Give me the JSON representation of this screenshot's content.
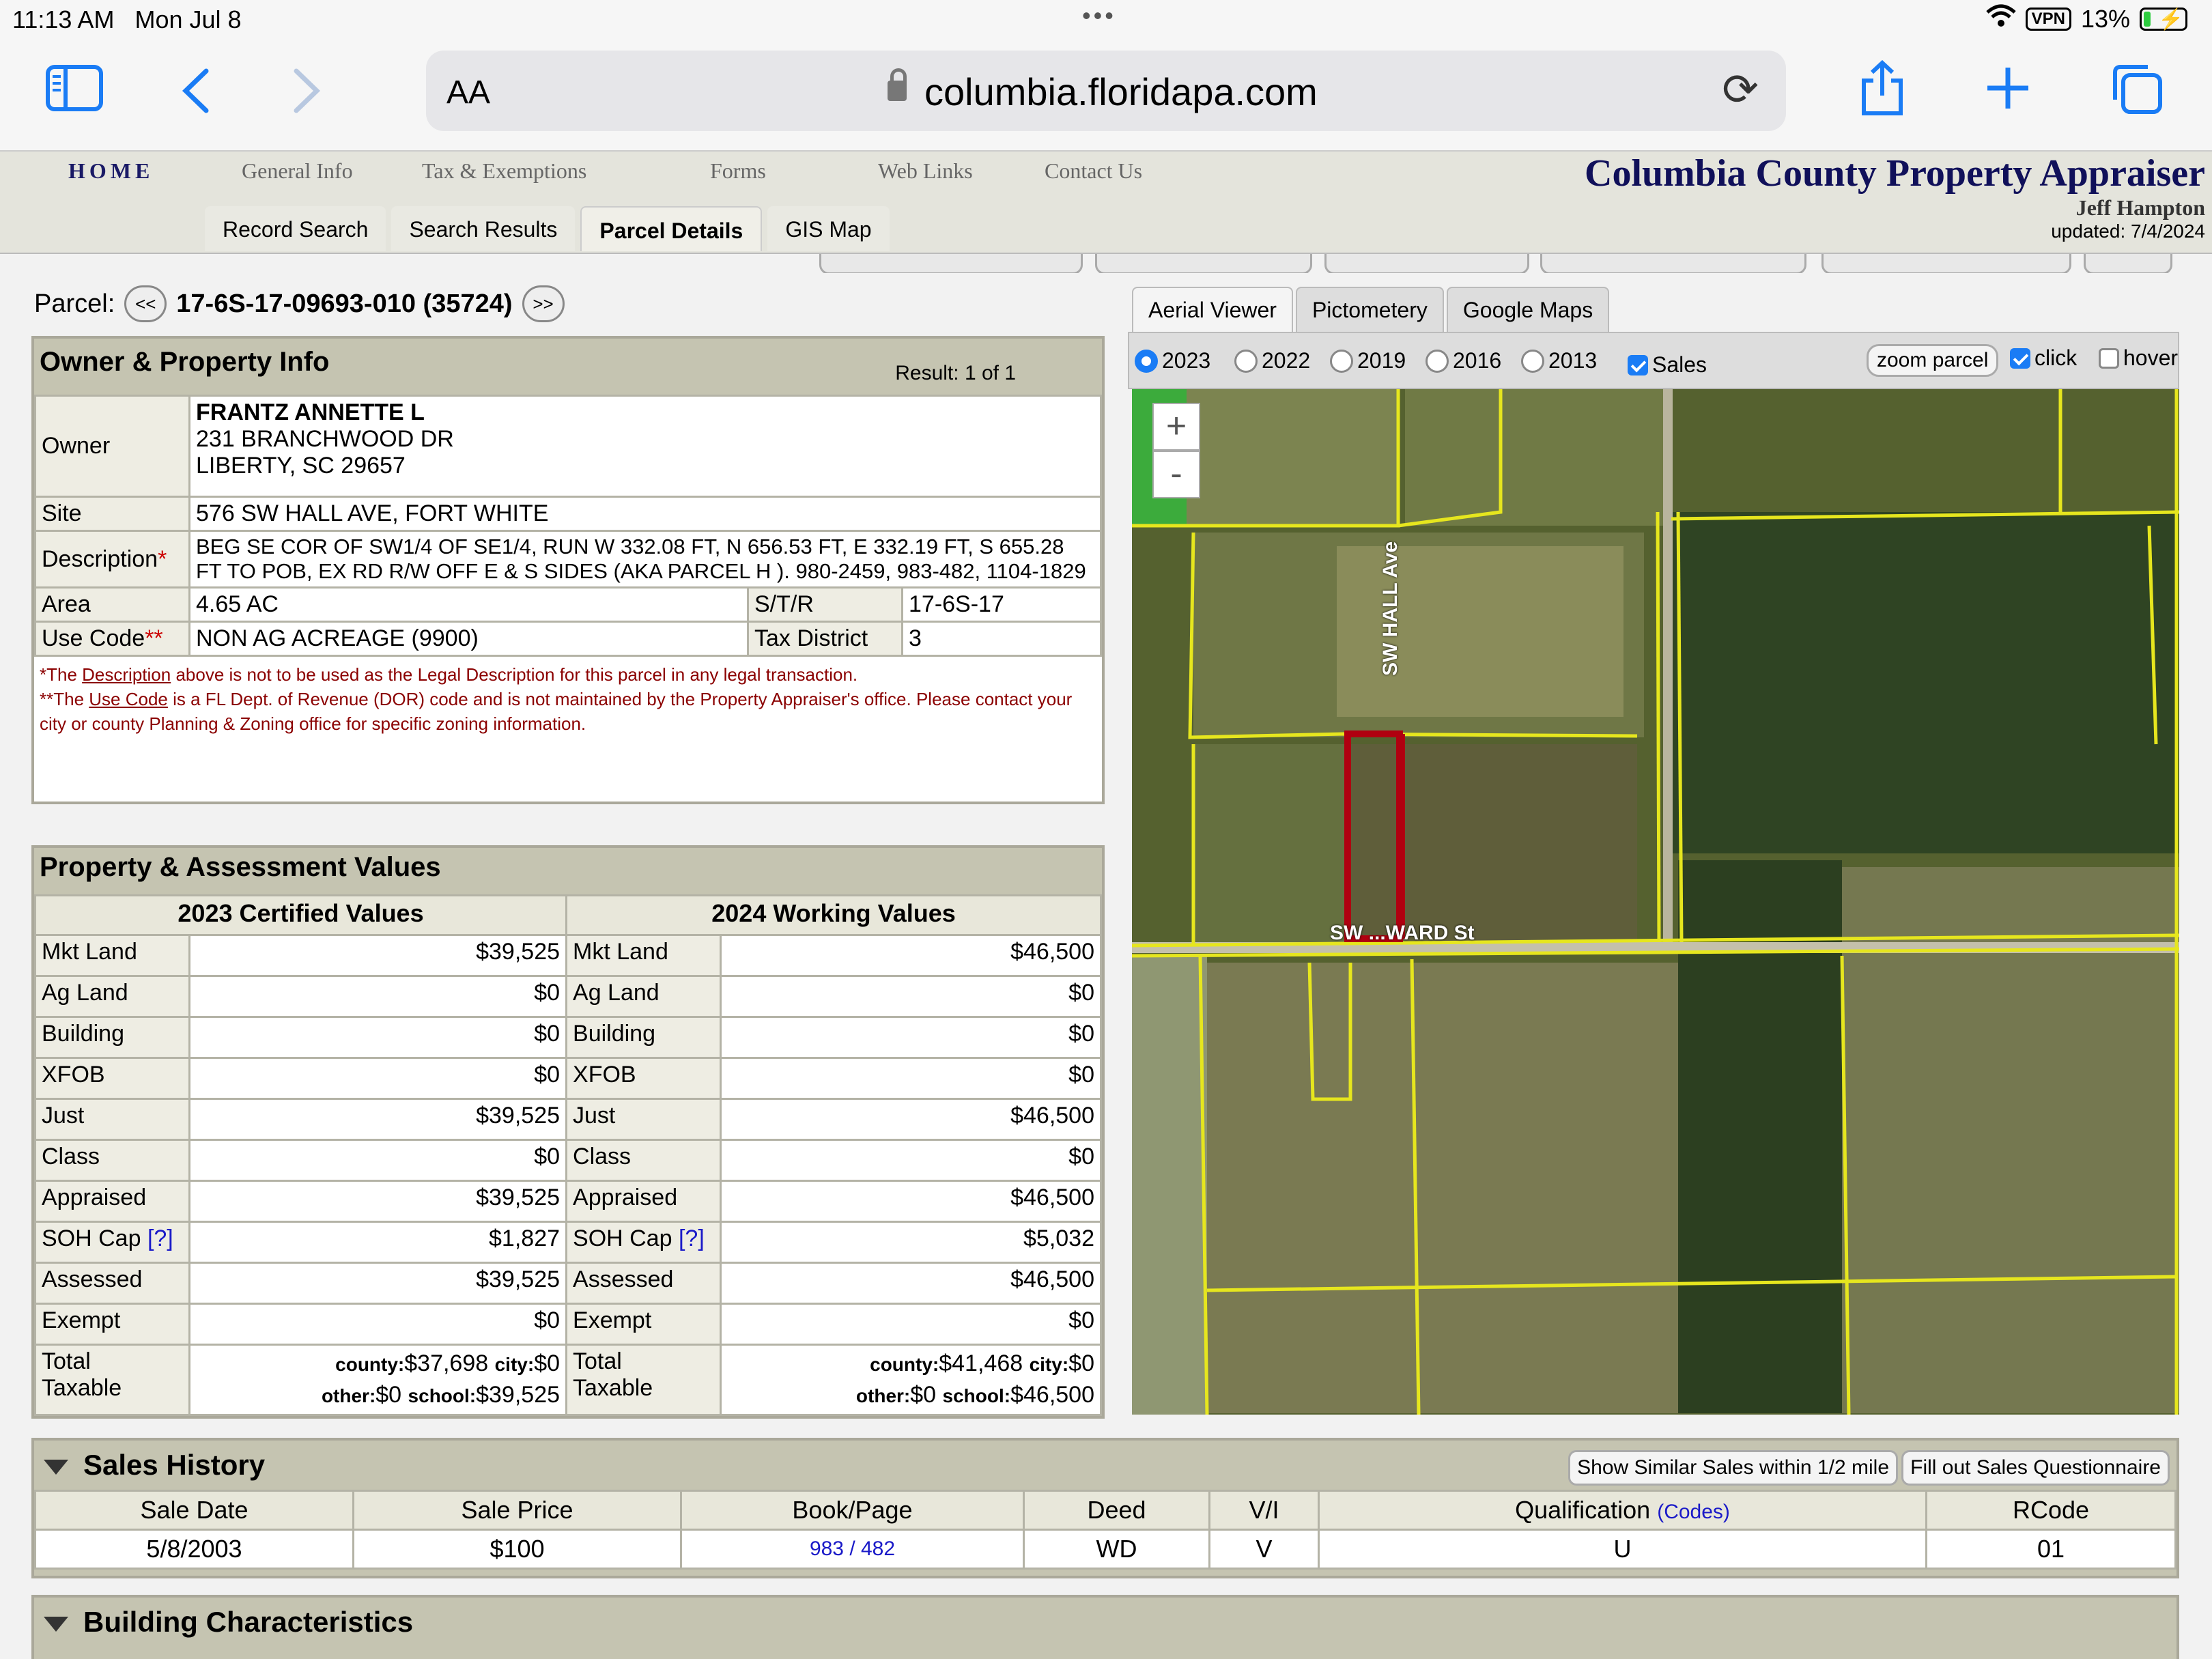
{
  "status": {
    "time": "11:13 AM",
    "date": "Mon Jul 8",
    "vpn": "VPN",
    "battery": "13%"
  },
  "browser": {
    "text_size": "AA",
    "url": "columbia.floridapa.com"
  },
  "nav": {
    "home": "HOME",
    "items": [
      "General Info",
      "Tax & Exemptions",
      "Forms",
      "Web Links",
      "Contact Us"
    ]
  },
  "tabs": [
    "Record Search",
    "Search Results",
    "Parcel Details",
    "GIS Map"
  ],
  "brand": {
    "title": "Columbia County Property Appraiser",
    "name": "Jeff Hampton",
    "updated": "updated: 7/4/2024"
  },
  "parcel": {
    "label": "Parcel:",
    "prev": "<<",
    "id": "17-6S-17-09693-010 (35724)",
    "next": ">>"
  },
  "owner": {
    "heading": "Owner & Property Info",
    "result": "Result: 1 of 1",
    "owner_label": "Owner",
    "owner_name": "FRANTZ ANNETTE L",
    "owner_addr1": "231 BRANCHWOOD DR",
    "owner_addr2": "LIBERTY, SC 29657",
    "site_label": "Site",
    "site": "576 SW HALL AVE, FORT WHITE",
    "desc_label": "Description",
    "desc": "BEG SE COR OF SW1/4 OF SE1/4, RUN W 332.08 FT, N 656.53 FT, E 332.19 FT, S 655.28 FT TO POB, EX RD R/W OFF E & S SIDES (AKA PARCEL H ). 980-2459, 983-482, 1104-1829",
    "area_label": "Area",
    "area": "4.65 AC",
    "str_label": "S/T/R",
    "str": "17-6S-17",
    "use_label": "Use Code",
    "use": "NON AG ACREAGE (9900)",
    "taxd_label": "Tax District",
    "taxd": "3",
    "note1a": "*The ",
    "note1b": "Description",
    "note1c": " above is not to be used as the Legal Description for this parcel in any legal transaction.",
    "note2a": "**The ",
    "note2b": "Use Code",
    "note2c": " is a FL Dept. of Revenue (DOR) code and is not maintained by the Property Appraiser's office. Please contact your city or county Planning & Zoning office for specific zoning information."
  },
  "values": {
    "heading": "Property & Assessment Values",
    "col1": "2023 Certified Values",
    "col2": "2024 Working Values",
    "rows": [
      {
        "label": "Mkt Land",
        "v1": "$39,525",
        "v2": "$46,500"
      },
      {
        "label": "Ag Land",
        "v1": "$0",
        "v2": "$0"
      },
      {
        "label": "Building",
        "v1": "$0",
        "v2": "$0"
      },
      {
        "label": "XFOB",
        "v1": "$0",
        "v2": "$0"
      },
      {
        "label": "Just",
        "v1": "$39,525",
        "v2": "$46,500"
      },
      {
        "label": "Class",
        "v1": "$0",
        "v2": "$0"
      },
      {
        "label": "Appraised",
        "v1": "$39,525",
        "v2": "$46,500"
      },
      {
        "label": "SOH Cap",
        "v1": "$1,827",
        "v2": "$5,032"
      },
      {
        "label": "Assessed",
        "v1": "$39,525",
        "v2": "$46,500"
      },
      {
        "label": "Exempt",
        "v1": "$0",
        "v2": "$0"
      }
    ],
    "help": "[?]",
    "total_label1": "Total",
    "total_label2": "Taxable",
    "t1": {
      "county_k": "county:",
      "county": "$37,698",
      "city_k": "city:",
      "city": "$0",
      "other_k": "other:",
      "other": "$0",
      "school_k": "school:",
      "school": "$39,525"
    },
    "t2": {
      "county_k": "county:",
      "county": "$41,468",
      "city_k": "city:",
      "city": "$0",
      "other_k": "other:",
      "other": "$0",
      "school_k": "school:",
      "school": "$46,500"
    }
  },
  "map": {
    "tabs": [
      "Aerial Viewer",
      "Pictometery",
      "Google Maps"
    ],
    "years": [
      "2023",
      "2022",
      "2019",
      "2016",
      "2013"
    ],
    "sales": "Sales",
    "zoom": "zoom parcel",
    "click": "click",
    "hover": "hover",
    "zoom_in": "+",
    "zoom_out": "-",
    "road1": "SW HALL Ave",
    "road2": "SW ...WARD St"
  },
  "sales": {
    "heading": "Sales History",
    "btn1": "Show Similar Sales within 1/2 mile",
    "btn2": "Fill out Sales Questionnaire",
    "cols": [
      "Sale Date",
      "Sale Price",
      "Book/Page",
      "Deed",
      "V/I",
      "Qualification",
      "RCode"
    ],
    "codes": "(Codes)",
    "row": {
      "date": "5/8/2003",
      "price": "$100",
      "book": "983 / 482",
      "deed": "WD",
      "vi": "V",
      "qual": "U",
      "rcode": "01"
    }
  },
  "building": {
    "heading": "Building Characteristics"
  }
}
